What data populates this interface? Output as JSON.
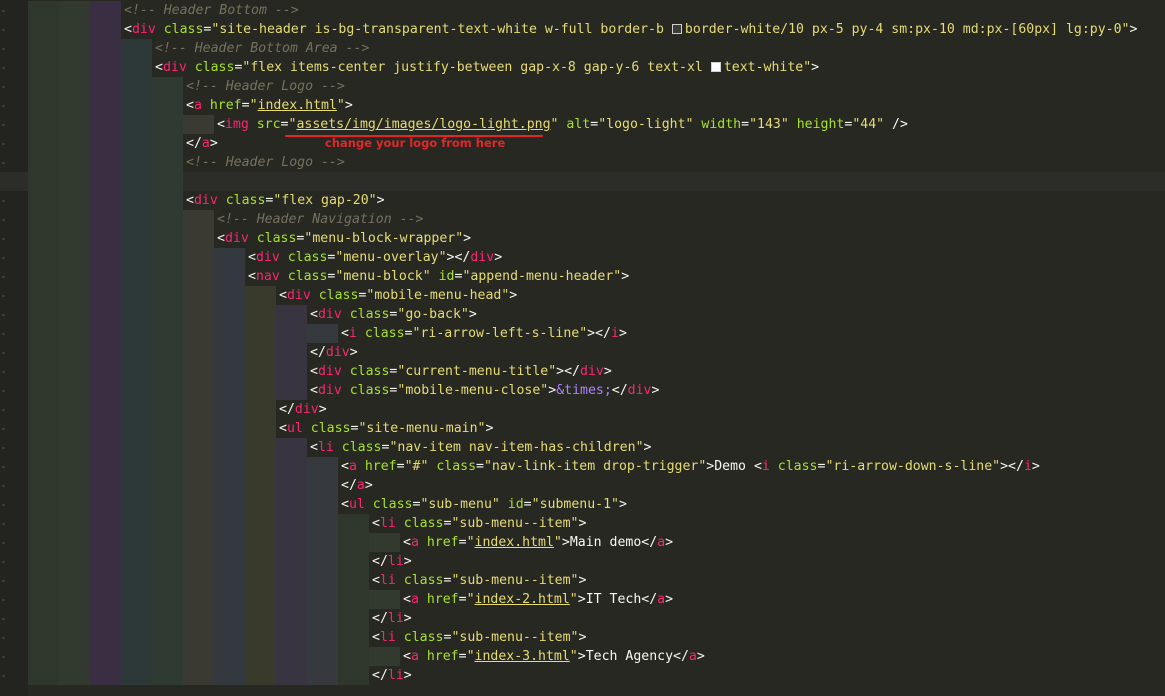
{
  "editor": {
    "theme": {
      "background": "#272822",
      "current_line": "#2c2d28",
      "comment": "#75715e",
      "tag": "#f92672",
      "attribute": "#a6e22e",
      "string": "#e6db74",
      "text": "#f8f8f2",
      "entity": "#ae81ff",
      "guide_colors": [
        "#2f362c",
        "#323a30",
        "#3a2f42",
        "#2d3838",
        "#2f3a33",
        "#3a3a33",
        "#34393f",
        "#3a3a2c",
        "#393540",
        "#363a3e"
      ]
    },
    "lines": [
      {
        "depth": 3,
        "tokens": [
          {
            "t": "<!-- Header Bottom -->",
            "c": "comment"
          }
        ]
      },
      {
        "depth": 3,
        "tokens": [
          {
            "t": "<",
            "c": "punct"
          },
          {
            "t": "div",
            "c": "tag"
          },
          {
            "t": " class",
            "c": "attr"
          },
          {
            "t": "=",
            "c": "punct"
          },
          {
            "t": "\"site-header is-bg-transparent-text-white w-full border-b ",
            "c": "str"
          },
          {
            "t": "",
            "c": "swatch",
            "color": "#ffffff1a"
          },
          {
            "t": "border-white/10 px-5 py-4 sm:px-10 md:px-[60px] lg:py-0\"",
            "c": "str"
          },
          {
            "t": ">",
            "c": "punct"
          }
        ]
      },
      {
        "depth": 4,
        "tokens": [
          {
            "t": "<!-- Header Bottom Area -->",
            "c": "comment"
          }
        ]
      },
      {
        "depth": 4,
        "tokens": [
          {
            "t": "<",
            "c": "punct"
          },
          {
            "t": "div",
            "c": "tag"
          },
          {
            "t": " class",
            "c": "attr"
          },
          {
            "t": "=",
            "c": "punct"
          },
          {
            "t": "\"flex items-center justify-between gap-x-8 gap-y-6 text-xl ",
            "c": "str"
          },
          {
            "t": "",
            "c": "swatch",
            "color": "#ffffff"
          },
          {
            "t": "text-white\"",
            "c": "str"
          },
          {
            "t": ">",
            "c": "punct"
          }
        ]
      },
      {
        "depth": 5,
        "tokens": [
          {
            "t": "<!-- Header Logo -->",
            "c": "comment"
          }
        ]
      },
      {
        "depth": 5,
        "tokens": [
          {
            "t": "<",
            "c": "punct"
          },
          {
            "t": "a",
            "c": "tag"
          },
          {
            "t": " href",
            "c": "attr"
          },
          {
            "t": "=",
            "c": "punct"
          },
          {
            "t": "\"",
            "c": "str"
          },
          {
            "t": "index.html",
            "c": "link"
          },
          {
            "t": "\"",
            "c": "str"
          },
          {
            "t": ">",
            "c": "punct"
          }
        ]
      },
      {
        "depth": 6,
        "tokens": [
          {
            "t": "<",
            "c": "punct"
          },
          {
            "t": "img",
            "c": "tag"
          },
          {
            "t": " src",
            "c": "attr"
          },
          {
            "t": "=",
            "c": "punct"
          },
          {
            "t": "\"",
            "c": "str"
          },
          {
            "t": "assets/img/images/logo-light.png",
            "c": "link"
          },
          {
            "t": "\"",
            "c": "str"
          },
          {
            "t": " alt",
            "c": "attr"
          },
          {
            "t": "=",
            "c": "punct"
          },
          {
            "t": "\"logo-light\"",
            "c": "str"
          },
          {
            "t": " width",
            "c": "attr"
          },
          {
            "t": "=",
            "c": "punct"
          },
          {
            "t": "\"143\"",
            "c": "str"
          },
          {
            "t": " height",
            "c": "attr"
          },
          {
            "t": "=",
            "c": "punct"
          },
          {
            "t": "\"44\"",
            "c": "str"
          },
          {
            "t": " />",
            "c": "punct"
          }
        ]
      },
      {
        "depth": 5,
        "tokens": [
          {
            "t": "</",
            "c": "punct"
          },
          {
            "t": "a",
            "c": "tag"
          },
          {
            "t": ">",
            "c": "punct"
          }
        ]
      },
      {
        "depth": 5,
        "tokens": [
          {
            "t": "<!-- Header Logo -->",
            "c": "comment"
          }
        ]
      },
      {
        "depth": 5,
        "current": true,
        "tokens": []
      },
      {
        "depth": 5,
        "tokens": [
          {
            "t": "<",
            "c": "punct"
          },
          {
            "t": "div",
            "c": "tag"
          },
          {
            "t": " class",
            "c": "attr"
          },
          {
            "t": "=",
            "c": "punct"
          },
          {
            "t": "\"flex gap-20\"",
            "c": "str"
          },
          {
            "t": ">",
            "c": "punct"
          }
        ]
      },
      {
        "depth": 6,
        "tokens": [
          {
            "t": "<!-- Header Navigation -->",
            "c": "comment"
          }
        ]
      },
      {
        "depth": 6,
        "tokens": [
          {
            "t": "<",
            "c": "punct"
          },
          {
            "t": "div",
            "c": "tag"
          },
          {
            "t": " class",
            "c": "attr"
          },
          {
            "t": "=",
            "c": "punct"
          },
          {
            "t": "\"menu-block-wrapper\"",
            "c": "str"
          },
          {
            "t": ">",
            "c": "punct"
          }
        ]
      },
      {
        "depth": 7,
        "tokens": [
          {
            "t": "<",
            "c": "punct"
          },
          {
            "t": "div",
            "c": "tag"
          },
          {
            "t": " class",
            "c": "attr"
          },
          {
            "t": "=",
            "c": "punct"
          },
          {
            "t": "\"menu-overlay\"",
            "c": "str"
          },
          {
            "t": "></",
            "c": "punct"
          },
          {
            "t": "div",
            "c": "tag"
          },
          {
            "t": ">",
            "c": "punct"
          }
        ]
      },
      {
        "depth": 7,
        "tokens": [
          {
            "t": "<",
            "c": "punct"
          },
          {
            "t": "nav",
            "c": "tag"
          },
          {
            "t": " class",
            "c": "attr"
          },
          {
            "t": "=",
            "c": "punct"
          },
          {
            "t": "\"menu-block\"",
            "c": "str"
          },
          {
            "t": " id",
            "c": "attr"
          },
          {
            "t": "=",
            "c": "punct"
          },
          {
            "t": "\"append-menu-header\"",
            "c": "str"
          },
          {
            "t": ">",
            "c": "punct"
          }
        ]
      },
      {
        "depth": 8,
        "tokens": [
          {
            "t": "<",
            "c": "punct"
          },
          {
            "t": "div",
            "c": "tag"
          },
          {
            "t": " class",
            "c": "attr"
          },
          {
            "t": "=",
            "c": "punct"
          },
          {
            "t": "\"mobile-menu-head\"",
            "c": "str"
          },
          {
            "t": ">",
            "c": "punct"
          }
        ]
      },
      {
        "depth": 9,
        "tokens": [
          {
            "t": "<",
            "c": "punct"
          },
          {
            "t": "div",
            "c": "tag"
          },
          {
            "t": " class",
            "c": "attr"
          },
          {
            "t": "=",
            "c": "punct"
          },
          {
            "t": "\"go-back\"",
            "c": "str"
          },
          {
            "t": ">",
            "c": "punct"
          }
        ]
      },
      {
        "depth": 10,
        "tokens": [
          {
            "t": "<",
            "c": "punct"
          },
          {
            "t": "i",
            "c": "tag"
          },
          {
            "t": " class",
            "c": "attr"
          },
          {
            "t": "=",
            "c": "punct"
          },
          {
            "t": "\"ri-arrow-left-s-line\"",
            "c": "str"
          },
          {
            "t": "></",
            "c": "punct"
          },
          {
            "t": "i",
            "c": "tag"
          },
          {
            "t": ">",
            "c": "punct"
          }
        ]
      },
      {
        "depth": 9,
        "tokens": [
          {
            "t": "</",
            "c": "punct"
          },
          {
            "t": "div",
            "c": "tag"
          },
          {
            "t": ">",
            "c": "punct"
          }
        ]
      },
      {
        "depth": 9,
        "tokens": [
          {
            "t": "<",
            "c": "punct"
          },
          {
            "t": "div",
            "c": "tag"
          },
          {
            "t": " class",
            "c": "attr"
          },
          {
            "t": "=",
            "c": "punct"
          },
          {
            "t": "\"current-menu-title\"",
            "c": "str"
          },
          {
            "t": "></",
            "c": "punct"
          },
          {
            "t": "div",
            "c": "tag"
          },
          {
            "t": ">",
            "c": "punct"
          }
        ]
      },
      {
        "depth": 9,
        "tokens": [
          {
            "t": "<",
            "c": "punct"
          },
          {
            "t": "div",
            "c": "tag"
          },
          {
            "t": " class",
            "c": "attr"
          },
          {
            "t": "=",
            "c": "punct"
          },
          {
            "t": "\"mobile-menu-close\"",
            "c": "str"
          },
          {
            "t": ">",
            "c": "punct"
          },
          {
            "t": "&times;",
            "c": "ent"
          },
          {
            "t": "</",
            "c": "punct"
          },
          {
            "t": "div",
            "c": "tag"
          },
          {
            "t": ">",
            "c": "punct"
          }
        ]
      },
      {
        "depth": 8,
        "tokens": [
          {
            "t": "</",
            "c": "punct"
          },
          {
            "t": "div",
            "c": "tag"
          },
          {
            "t": ">",
            "c": "punct"
          }
        ]
      },
      {
        "depth": 8,
        "tokens": [
          {
            "t": "<",
            "c": "punct"
          },
          {
            "t": "ul",
            "c": "tag"
          },
          {
            "t": " class",
            "c": "attr"
          },
          {
            "t": "=",
            "c": "punct"
          },
          {
            "t": "\"site-menu-main\"",
            "c": "str"
          },
          {
            "t": ">",
            "c": "punct"
          }
        ]
      },
      {
        "depth": 9,
        "tokens": [
          {
            "t": "<",
            "c": "punct"
          },
          {
            "t": "li",
            "c": "tag"
          },
          {
            "t": " class",
            "c": "attr"
          },
          {
            "t": "=",
            "c": "punct"
          },
          {
            "t": "\"nav-item nav-item-has-children\"",
            "c": "str"
          },
          {
            "t": ">",
            "c": "punct"
          }
        ]
      },
      {
        "depth": 10,
        "tokens": [
          {
            "t": "<",
            "c": "punct"
          },
          {
            "t": "a",
            "c": "tag"
          },
          {
            "t": " href",
            "c": "attr"
          },
          {
            "t": "=",
            "c": "punct"
          },
          {
            "t": "\"#\"",
            "c": "str"
          },
          {
            "t": " class",
            "c": "attr"
          },
          {
            "t": "=",
            "c": "punct"
          },
          {
            "t": "\"nav-link-item drop-trigger\"",
            "c": "str"
          },
          {
            "t": ">Demo ",
            "c": "punct"
          },
          {
            "t": "<",
            "c": "punct"
          },
          {
            "t": "i",
            "c": "tag"
          },
          {
            "t": " class",
            "c": "attr"
          },
          {
            "t": "=",
            "c": "punct"
          },
          {
            "t": "\"ri-arrow-down-s-line\"",
            "c": "str"
          },
          {
            "t": "></",
            "c": "punct"
          },
          {
            "t": "i",
            "c": "tag"
          },
          {
            "t": ">",
            "c": "punct"
          }
        ]
      },
      {
        "depth": 10,
        "tokens": [
          {
            "t": "</",
            "c": "punct"
          },
          {
            "t": "a",
            "c": "tag"
          },
          {
            "t": ">",
            "c": "punct"
          }
        ]
      },
      {
        "depth": 10,
        "tokens": [
          {
            "t": "<",
            "c": "punct"
          },
          {
            "t": "ul",
            "c": "tag"
          },
          {
            "t": " class",
            "c": "attr"
          },
          {
            "t": "=",
            "c": "punct"
          },
          {
            "t": "\"sub-menu\"",
            "c": "str"
          },
          {
            "t": " id",
            "c": "attr"
          },
          {
            "t": "=",
            "c": "punct"
          },
          {
            "t": "\"submenu-1\"",
            "c": "str"
          },
          {
            "t": ">",
            "c": "punct"
          }
        ]
      },
      {
        "depth": 11,
        "tokens": [
          {
            "t": "<",
            "c": "punct"
          },
          {
            "t": "li",
            "c": "tag"
          },
          {
            "t": " class",
            "c": "attr"
          },
          {
            "t": "=",
            "c": "punct"
          },
          {
            "t": "\"sub-menu--item\"",
            "c": "str"
          },
          {
            "t": ">",
            "c": "punct"
          }
        ]
      },
      {
        "depth": 12,
        "tokens": [
          {
            "t": "<",
            "c": "punct"
          },
          {
            "t": "a",
            "c": "tag"
          },
          {
            "t": " href",
            "c": "attr"
          },
          {
            "t": "=",
            "c": "punct"
          },
          {
            "t": "\"",
            "c": "str"
          },
          {
            "t": "index.html",
            "c": "link"
          },
          {
            "t": "\"",
            "c": "str"
          },
          {
            "t": ">Main demo",
            "c": "punct"
          },
          {
            "t": "</",
            "c": "punct"
          },
          {
            "t": "a",
            "c": "tag"
          },
          {
            "t": ">",
            "c": "punct"
          }
        ]
      },
      {
        "depth": 11,
        "tokens": [
          {
            "t": "</",
            "c": "punct"
          },
          {
            "t": "li",
            "c": "tag"
          },
          {
            "t": ">",
            "c": "punct"
          }
        ]
      },
      {
        "depth": 11,
        "tokens": [
          {
            "t": "<",
            "c": "punct"
          },
          {
            "t": "li",
            "c": "tag"
          },
          {
            "t": " class",
            "c": "attr"
          },
          {
            "t": "=",
            "c": "punct"
          },
          {
            "t": "\"sub-menu--item\"",
            "c": "str"
          },
          {
            "t": ">",
            "c": "punct"
          }
        ]
      },
      {
        "depth": 12,
        "tokens": [
          {
            "t": "<",
            "c": "punct"
          },
          {
            "t": "a",
            "c": "tag"
          },
          {
            "t": " href",
            "c": "attr"
          },
          {
            "t": "=",
            "c": "punct"
          },
          {
            "t": "\"",
            "c": "str"
          },
          {
            "t": "index-2.html",
            "c": "link"
          },
          {
            "t": "\"",
            "c": "str"
          },
          {
            "t": ">IT Tech",
            "c": "punct"
          },
          {
            "t": "</",
            "c": "punct"
          },
          {
            "t": "a",
            "c": "tag"
          },
          {
            "t": ">",
            "c": "punct"
          }
        ]
      },
      {
        "depth": 11,
        "tokens": [
          {
            "t": "</",
            "c": "punct"
          },
          {
            "t": "li",
            "c": "tag"
          },
          {
            "t": ">",
            "c": "punct"
          }
        ]
      },
      {
        "depth": 11,
        "tokens": [
          {
            "t": "<",
            "c": "punct"
          },
          {
            "t": "li",
            "c": "tag"
          },
          {
            "t": " class",
            "c": "attr"
          },
          {
            "t": "=",
            "c": "punct"
          },
          {
            "t": "\"sub-menu--item\"",
            "c": "str"
          },
          {
            "t": ">",
            "c": "punct"
          }
        ]
      },
      {
        "depth": 12,
        "tokens": [
          {
            "t": "<",
            "c": "punct"
          },
          {
            "t": "a",
            "c": "tag"
          },
          {
            "t": " href",
            "c": "attr"
          },
          {
            "t": "=",
            "c": "punct"
          },
          {
            "t": "\"",
            "c": "str"
          },
          {
            "t": "index-3.html",
            "c": "link"
          },
          {
            "t": "\"",
            "c": "str"
          },
          {
            "t": ">Tech Agency",
            "c": "punct"
          },
          {
            "t": "</",
            "c": "punct"
          },
          {
            "t": "a",
            "c": "tag"
          },
          {
            "t": ">",
            "c": "punct"
          }
        ]
      },
      {
        "depth": 11,
        "tokens": [
          {
            "t": "</",
            "c": "punct"
          },
          {
            "t": "li",
            "c": "tag"
          },
          {
            "t": ">",
            "c": "punct"
          }
        ]
      }
    ]
  },
  "annotation": {
    "text": "change your logo from here",
    "color": "#e3262a"
  }
}
